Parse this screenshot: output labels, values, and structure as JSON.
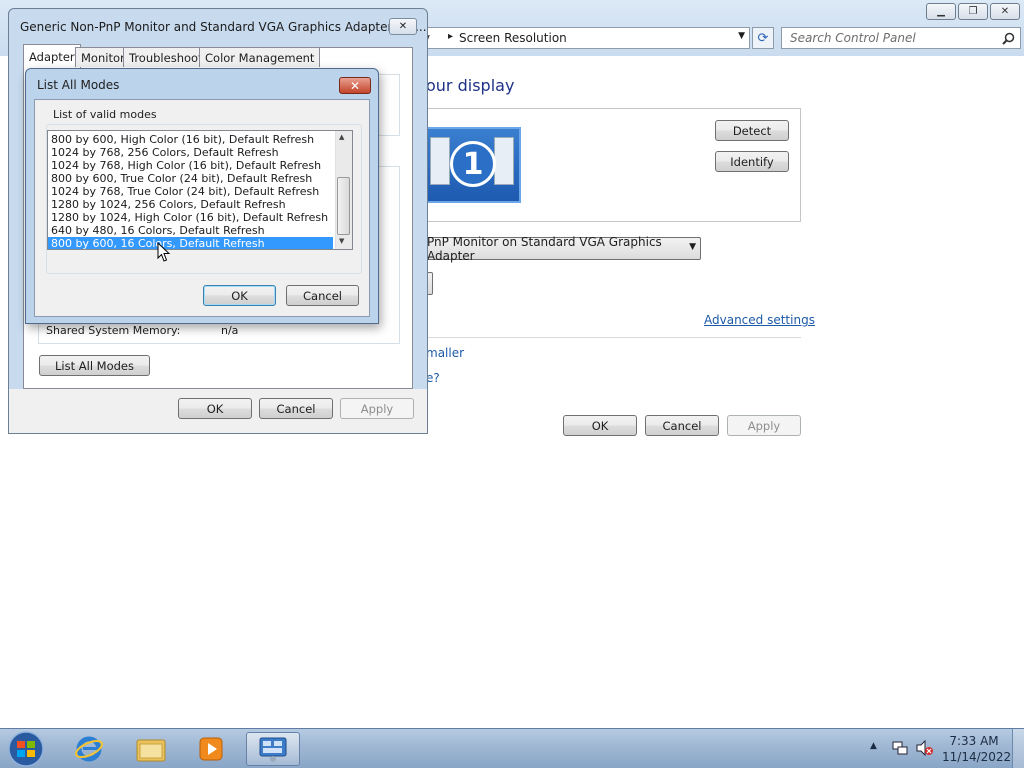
{
  "control_panel": {
    "breadcrumb_partial": "y",
    "breadcrumb_arrow": "▸",
    "breadcrumb_current": "Screen Resolution",
    "search_placeholder": "Search Control Panel",
    "heading_partial": "our display",
    "detect_label": "Detect",
    "identify_label": "Identify",
    "monitor_number": "1",
    "display_dropdown_value": "PnP Monitor on Standard VGA Graphics Adapter",
    "advanced_settings_link": "Advanced settings",
    "link_smaller_partial": "maller",
    "link_question_partial": "e?",
    "ok_label": "OK",
    "cancel_label": "Cancel",
    "apply_label": "Apply"
  },
  "properties_dialog": {
    "title": "Generic Non-PnP Monitor and Standard VGA Graphics Adapter Pro...",
    "close_glyph": "✕",
    "tabs": [
      "Adapter",
      "Monitor",
      "Troubleshoot",
      "Color Management"
    ],
    "shared_memory_label": "Shared System Memory:",
    "shared_memory_value": "n/a",
    "list_all_modes_button": "List All Modes",
    "ok_label": "OK",
    "cancel_label": "Cancel",
    "apply_label": "Apply"
  },
  "list_all_modes_dialog": {
    "title": "List All Modes",
    "close_glyph": "✕",
    "group_label": "List of valid modes",
    "modes": [
      "800 by 600, High Color (16 bit), Default Refresh",
      "1024 by 768, 256 Colors, Default Refresh",
      "1024 by 768, High Color (16 bit), Default Refresh",
      "800 by 600, True Color (24 bit), Default Refresh",
      "1024 by 768, True Color (24 bit), Default Refresh",
      "1280 by 1024, 256 Colors, Default Refresh",
      "1280 by 1024, High Color (16 bit), Default Refresh",
      "640 by 480, 16 Colors, Default Refresh",
      "800 by 600, 16 Colors, Default Refresh"
    ],
    "selected_index": 8,
    "ok_label": "OK",
    "cancel_label": "Cancel"
  },
  "taskbar": {
    "time": "7:33 AM",
    "date": "11/14/2022"
  },
  "colors": {
    "selection": "#3399ff",
    "link": "#1c5aa8",
    "heading": "#1e3287"
  }
}
